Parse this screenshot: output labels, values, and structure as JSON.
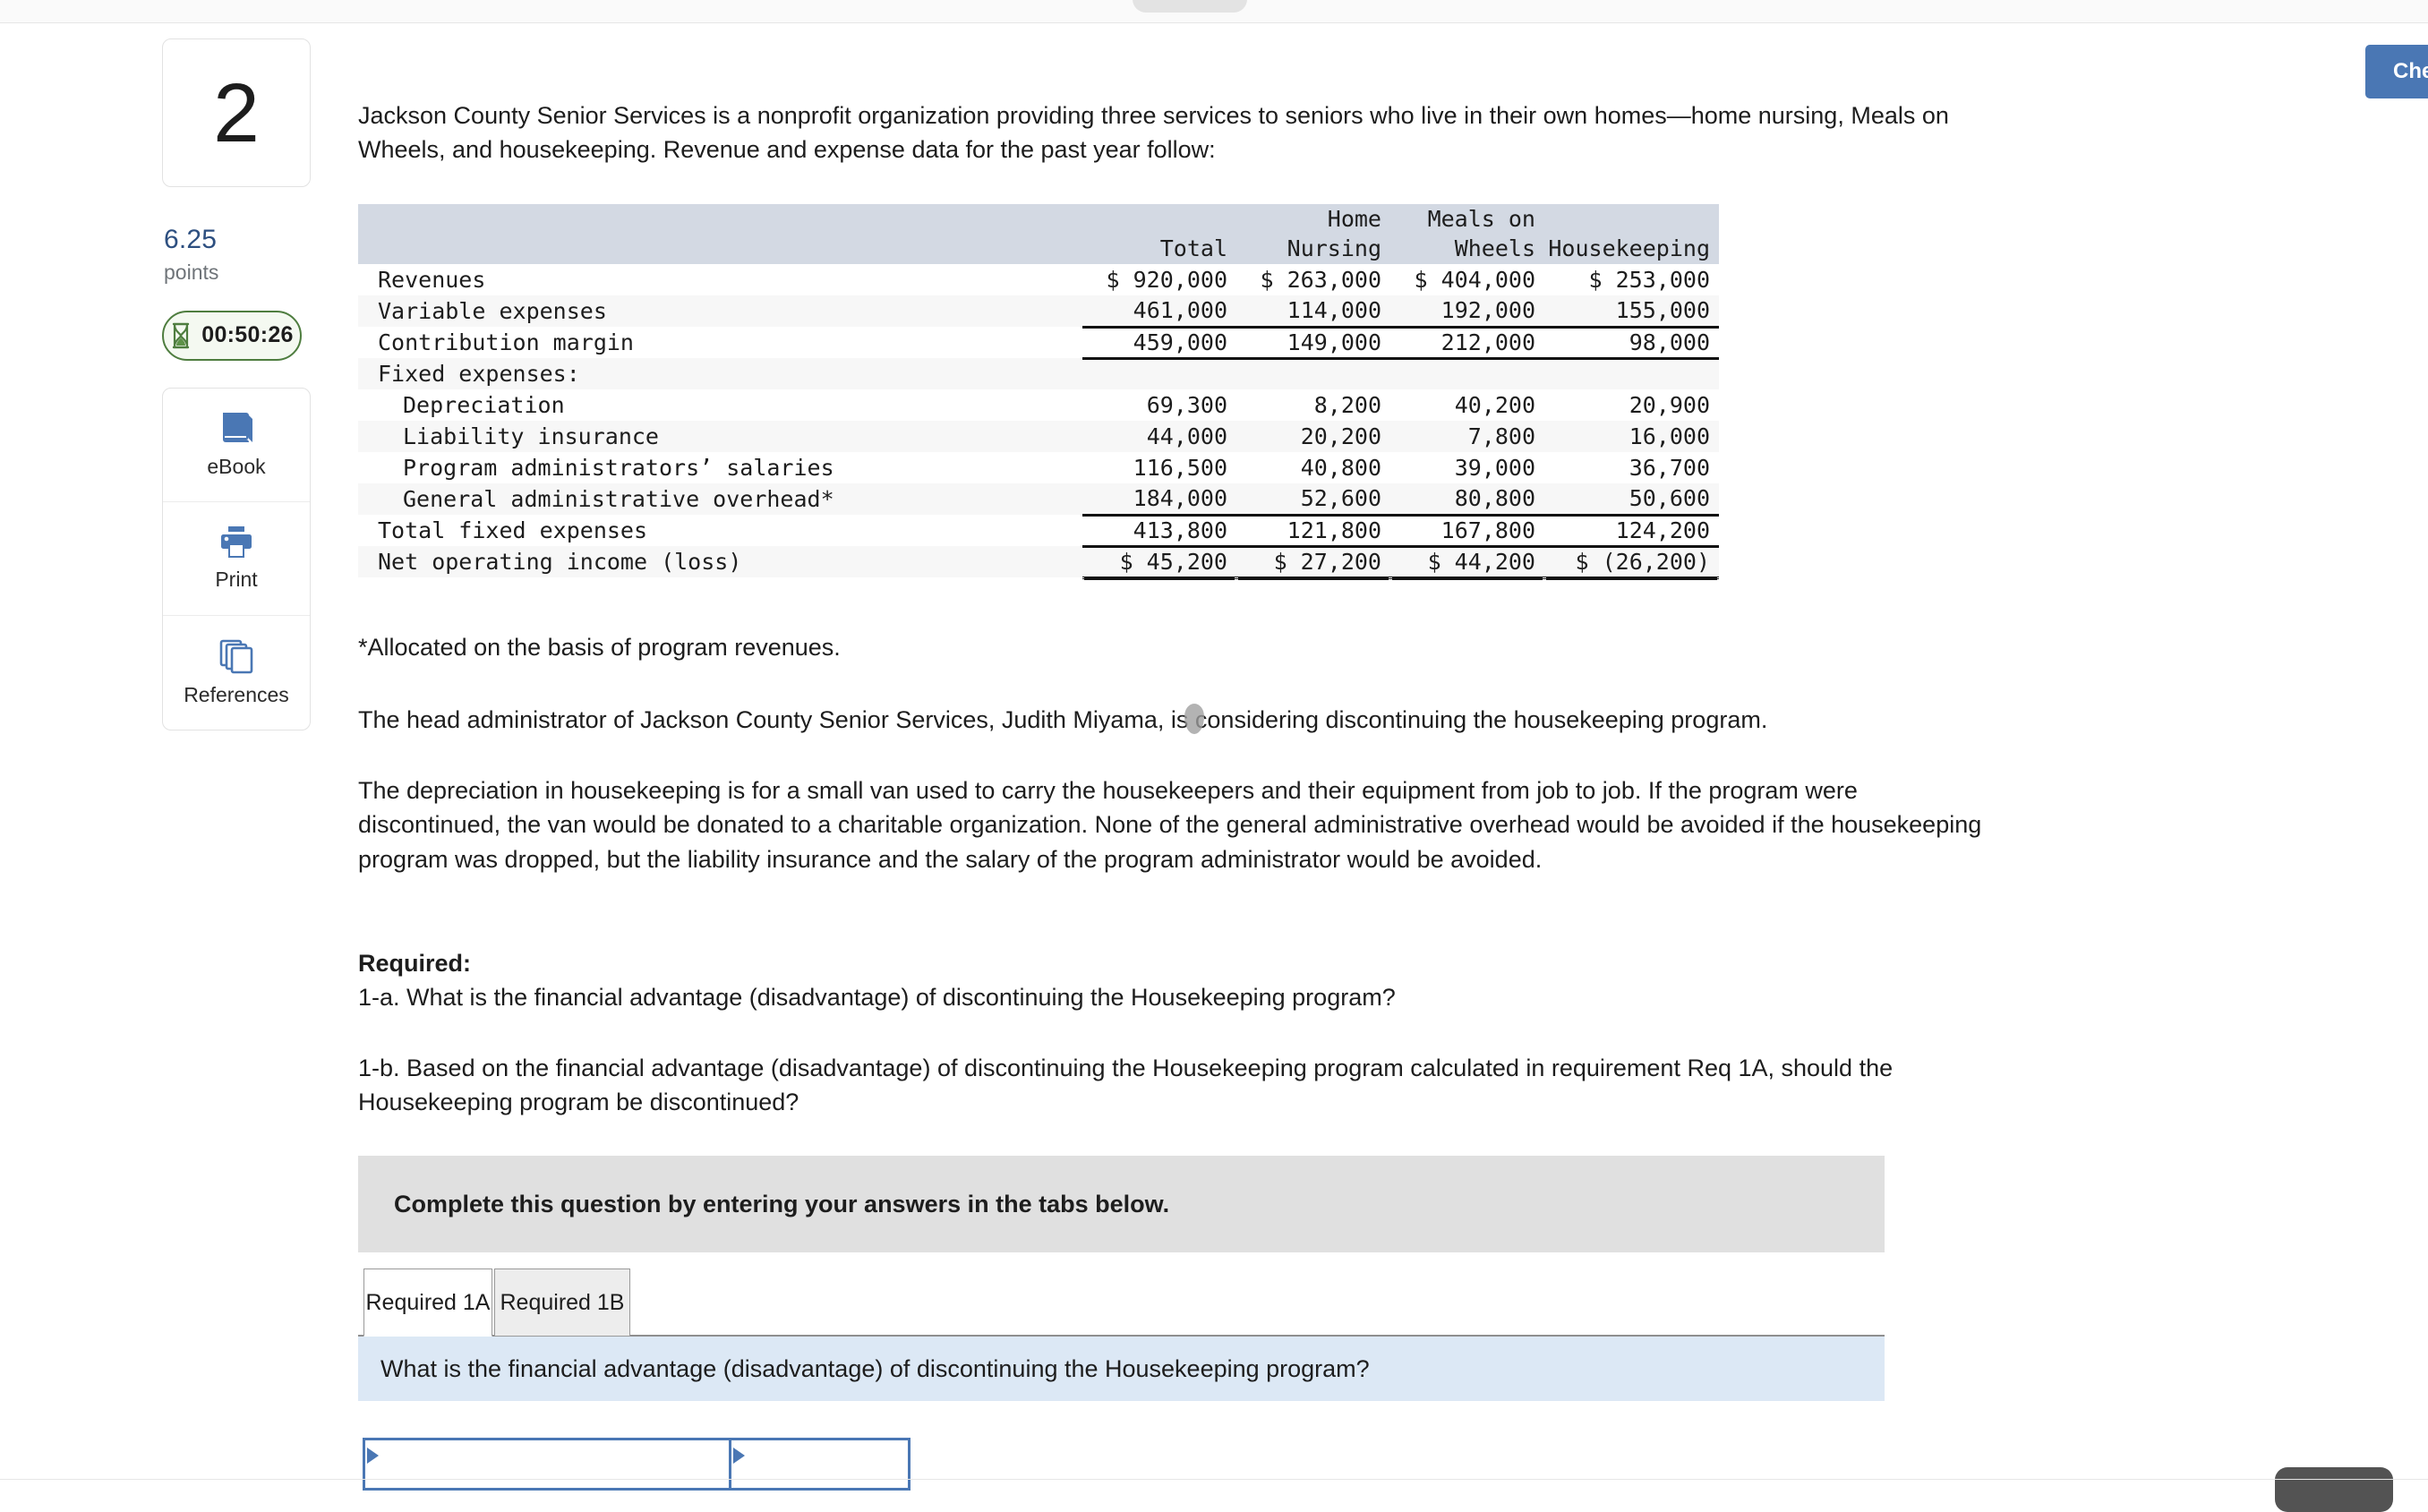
{
  "topbar": {
    "pill": ""
  },
  "sidebar": {
    "question_number": "2",
    "points_value": "6.25",
    "points_label": "points",
    "timer": "00:50:26",
    "tools": [
      {
        "icon": "ebook-icon",
        "label": "eBook"
      },
      {
        "icon": "print-icon",
        "label": "Print"
      },
      {
        "icon": "references-icon",
        "label": "References"
      }
    ]
  },
  "header": {
    "check_my_work": "Check my work"
  },
  "content": {
    "intro": "Jackson County Senior Services is a nonprofit organization providing three services to seniors who live in their own homes—home nursing, Meals on Wheels, and housekeeping. Revenue and expense data for the past year follow:",
    "footnote": "*Allocated on the basis of program revenues.",
    "para2": "The head administrator of Jackson County Senior Services, Judith Miyama, is considering discontinuing the housekeeping program.",
    "para3": "The depreciation in housekeeping is for a small van used to carry the housekeepers and their equipment from job to job. If the program were discontinued, the van would be donated to a charitable organization. None of the general administrative overhead would be avoided if the housekeeping program was dropped, but the liability insurance and the salary of the program administrator would be avoided.",
    "required_heading": "Required:",
    "required_a": "1-a. What is the financial advantage (disadvantage) of discontinuing the Housekeeping program?",
    "required_b": "1-b. Based on the financial advantage (disadvantage) of discontinuing the Housekeeping program calculated in requirement Req 1A, should the Housekeeping program be discontinued?"
  },
  "table": {
    "header_line1": [
      "",
      "",
      "Home",
      "Meals on",
      ""
    ],
    "header_line2": [
      "",
      "Total",
      "Nursing",
      "Wheels",
      "Housekeeping"
    ],
    "rows": [
      {
        "label": "Revenues",
        "indent": false,
        "values": [
          "$ 920,000",
          "$ 263,000",
          "$ 404,000",
          "$ 253,000"
        ]
      },
      {
        "label": "Variable expenses",
        "indent": false,
        "values": [
          "461,000",
          "114,000",
          "192,000",
          "155,000"
        ]
      },
      {
        "label": "Contribution margin",
        "indent": false,
        "values": [
          "459,000",
          "149,000",
          "212,000",
          "98,000"
        ]
      },
      {
        "label": "Fixed expenses:",
        "indent": false,
        "values": [
          "",
          "",
          "",
          ""
        ]
      },
      {
        "label": "Depreciation",
        "indent": true,
        "values": [
          "69,300",
          "8,200",
          "40,200",
          "20,900"
        ]
      },
      {
        "label": "Liability insurance",
        "indent": true,
        "values": [
          "44,000",
          "20,200",
          "7,800",
          "16,000"
        ]
      },
      {
        "label": "Program administrators’ salaries",
        "indent": true,
        "values": [
          "116,500",
          "40,800",
          "39,000",
          "36,700"
        ]
      },
      {
        "label": "General administrative overhead*",
        "indent": true,
        "values": [
          "184,000",
          "52,600",
          "80,800",
          "50,600"
        ]
      },
      {
        "label": "Total fixed expenses",
        "indent": false,
        "values": [
          "413,800",
          "121,800",
          "167,800",
          "124,200"
        ]
      },
      {
        "label": "Net operating income (loss)",
        "indent": false,
        "values": [
          "$ 45,200",
          "$ 27,200",
          "$ 44,200",
          "$ (26,200)"
        ]
      }
    ]
  },
  "answer_panel": {
    "banner": "Complete this question by entering your answers in the tabs below.",
    "tabs": [
      {
        "label": "Required 1A",
        "active": true
      },
      {
        "label": "Required 1B",
        "active": false
      }
    ],
    "question": "What is the financial advantage (disadvantage) of discontinuing the Housekeeping program?",
    "grid_cells": [
      "",
      ""
    ]
  },
  "colors": {
    "accent_blue": "#4a77b4",
    "points_blue": "#2d4f80",
    "timer_green": "#4e7d3f",
    "table_header_bg": "#d3d9e3",
    "question_bar_blue": "#dce8f5",
    "banner_grey": "#e0e0e0"
  }
}
